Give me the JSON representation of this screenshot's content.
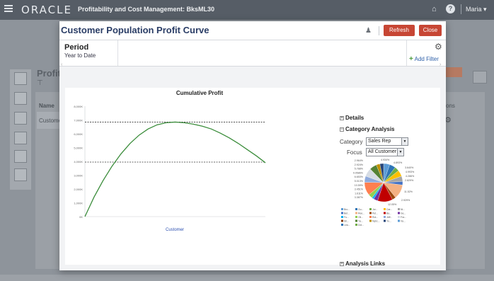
{
  "topbar": {
    "logo": "ORACLE",
    "app_title": "Profitability and Cost Management: BksML30",
    "user": "Maria ▾"
  },
  "background": {
    "page_title": "Profit",
    "filter_glyph": "⊤",
    "col_name": "Name",
    "row_name": "Custome",
    "col_actions": "ons"
  },
  "modal": {
    "title": "Customer Population Profit Curve",
    "refresh_label": "Refresh",
    "close_label": "Close",
    "period_label": "Period",
    "period_value": "Year to Date",
    "add_filter_label": "Add Filter"
  },
  "analysis": {
    "details_label": "Details",
    "category_analysis_label": "Category Analysis",
    "category_label": "Category",
    "category_value": "Sales Rep",
    "focus_label": "Focus",
    "focus_value": "All Customer",
    "analysis_links_label": "Analysis Links"
  },
  "chart_data": {
    "type": "line",
    "title": "Cumulative Profit",
    "xlabel": "Customer",
    "ylabel": "",
    "yticks": [
      "0K",
      "1,000K",
      "2,000K",
      "3,000K",
      "4,000K",
      "5,000K",
      "6,000K",
      "7,000K",
      "8,000K"
    ],
    "ylim": [
      0,
      8000
    ],
    "xlim": [
      0,
      100
    ],
    "series": [
      {
        "x": [
          0,
          5,
          10,
          15,
          20,
          25,
          30,
          35,
          40,
          45,
          50,
          55,
          60,
          65,
          70,
          75,
          80,
          85,
          90,
          95,
          100
        ],
        "values": [
          0,
          1400,
          2600,
          3650,
          4550,
          5300,
          5900,
          6350,
          6650,
          6800,
          6850,
          6800,
          6700,
          6550,
          6350,
          6050,
          5700,
          5300,
          4850,
          4400,
          3900
        ]
      }
    ],
    "reference_lines": [
      6850,
      3950
    ],
    "color": "#3a8c3a"
  },
  "pie_data": {
    "type": "pie",
    "labels": [
      "2.964%",
      "2.924%",
      "5.788%",
      "0.0586%",
      "6.653%",
      "5.013%",
      "10.59%",
      "3.451%",
      "1.611%",
      "3.387%",
      "4.934%",
      "4.893%",
      "3.640%",
      "4.993%",
      "4.286%",
      "2.829%",
      "11.52%",
      "2.929%",
      "12.05%"
    ],
    "values": [
      4.934,
      4.893,
      3.64,
      4.993,
      4.286,
      2.829,
      11.52,
      2.929,
      12.05,
      3.387,
      1.611,
      3.451,
      10.59,
      5.013,
      6.653,
      0.0586,
      5.788,
      2.924,
      2.964
    ],
    "colors": [
      "#5b9bd5",
      "#2e75b6",
      "#70ad47",
      "#ffc000",
      "#a5a5a5",
      "#4472c4",
      "#f4b183",
      "#9e480e",
      "#c00000",
      "#7030a0",
      "#00b0f0",
      "#92d050",
      "#ff7f50",
      "#8faadc",
      "#d6dce4",
      "#843c0c",
      "#548235",
      "#bf9000",
      "#264478"
    ],
    "legend": [
      "Bro...",
      "Gu...",
      "Jor...",
      "Car...",
      "Ni...",
      "Bet...",
      "Ree...",
      "Pet...",
      "Ba...",
      "Ge...",
      "Fu...",
      "Oli...",
      "Rot...",
      "Jeff...",
      "Fra...",
      "Sil...",
      "Ya...",
      "Nyhc...",
      "Yo...",
      "Va...",
      "Lea...",
      "Dol..."
    ]
  }
}
